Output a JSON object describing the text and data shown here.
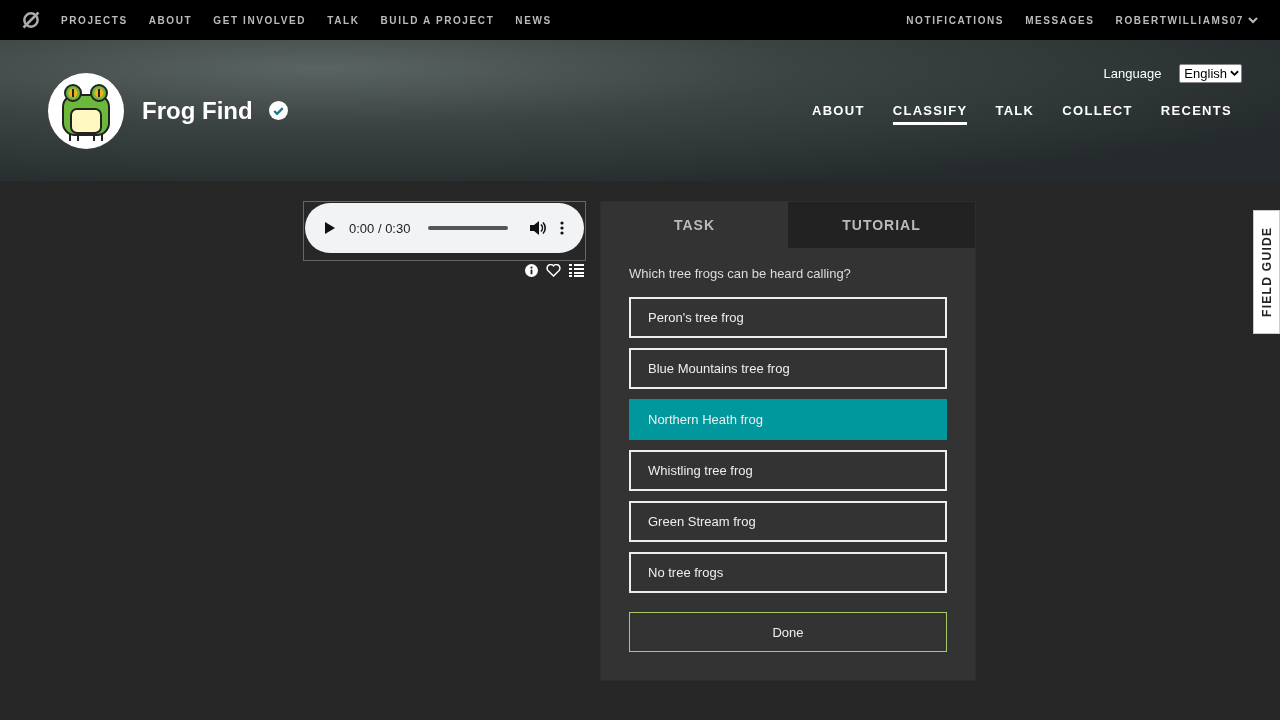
{
  "site_nav": {
    "left": [
      "PROJECTS",
      "ABOUT",
      "GET INVOLVED",
      "TALK",
      "BUILD A PROJECT",
      "NEWS"
    ],
    "right": [
      "NOTIFICATIONS",
      "MESSAGES"
    ],
    "user": "ROBERTWILLIAMS07"
  },
  "project": {
    "name": "Frog Find",
    "verified": true
  },
  "language": {
    "label": "Language",
    "value": "English"
  },
  "project_nav": [
    {
      "label": "ABOUT",
      "selected": false
    },
    {
      "label": "CLASSIFY",
      "selected": true
    },
    {
      "label": "TALK",
      "selected": false
    },
    {
      "label": "COLLECT",
      "selected": false
    },
    {
      "label": "RECENTS",
      "selected": false
    }
  ],
  "audio": {
    "time": "0:00 / 0:30",
    "level": 0
  },
  "task": {
    "tabs": [
      {
        "label": "TASK",
        "selected": true
      },
      {
        "label": "TUTORIAL",
        "selected": false
      }
    ],
    "question": "Which tree frogs can be heard calling?",
    "answers": [
      {
        "label": "Peron's tree frog",
        "selected": false
      },
      {
        "label": "Blue Mountains tree frog",
        "selected": false
      },
      {
        "label": "Northern Heath frog",
        "selected": true
      },
      {
        "label": "Whistling tree frog",
        "selected": false
      },
      {
        "label": "Green Stream frog",
        "selected": false
      },
      {
        "label": "No tree frogs",
        "selected": false
      }
    ],
    "done": "Done"
  },
  "field_guide": "FIELD GUIDE"
}
